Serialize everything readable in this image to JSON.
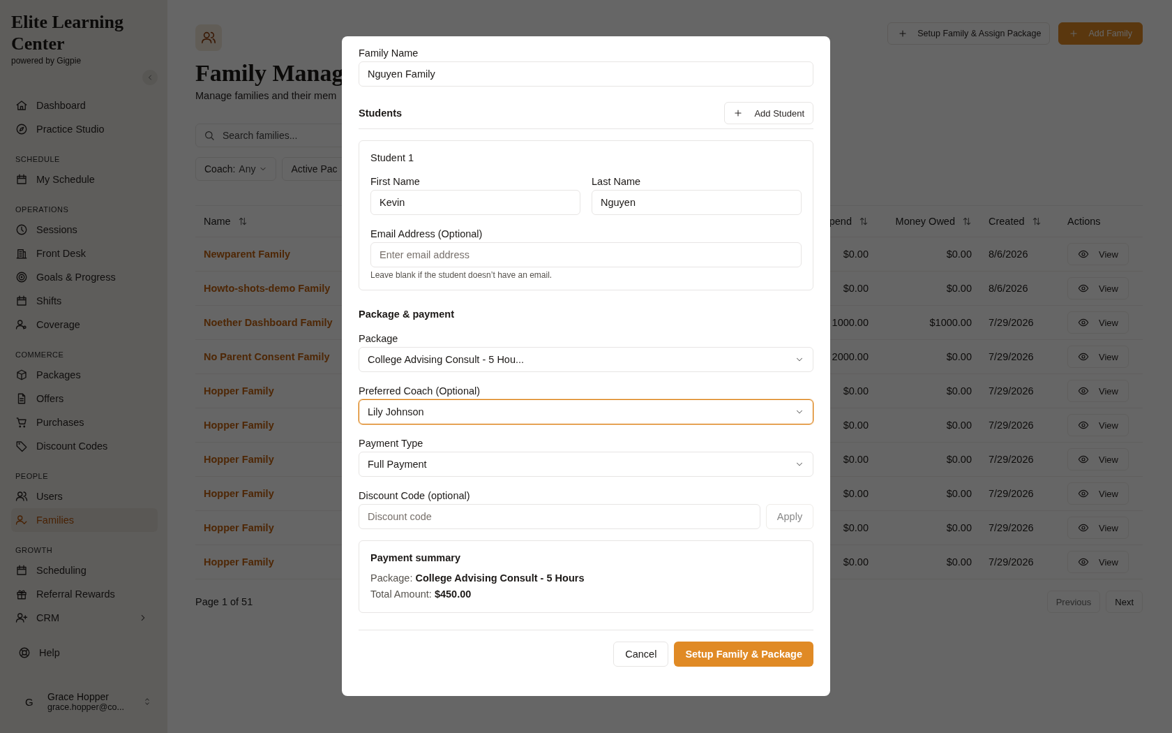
{
  "sidebar": {
    "brand": "Elite Learning Center",
    "tagline": "powered by Gigpie",
    "sections": [
      {
        "items": [
          {
            "label": "Dashboard",
            "selected": false
          },
          {
            "label": "Practice Studio",
            "selected": false
          }
        ]
      },
      {
        "heading": "SCHEDULE",
        "items": [
          {
            "label": "My Schedule",
            "selected": false
          }
        ]
      },
      {
        "heading": "OPERATIONS",
        "items": [
          {
            "label": "Sessions",
            "selected": false
          },
          {
            "label": "Front Desk",
            "selected": false
          },
          {
            "label": "Goals & Progress",
            "selected": false
          },
          {
            "label": "Shifts",
            "selected": false
          },
          {
            "label": "Coverage",
            "selected": false
          }
        ]
      },
      {
        "heading": "COMMERCE",
        "items": [
          {
            "label": "Packages",
            "selected": false
          },
          {
            "label": "Offers",
            "selected": false
          },
          {
            "label": "Purchases",
            "selected": false
          },
          {
            "label": "Discount Codes",
            "selected": false
          }
        ]
      },
      {
        "heading": "PEOPLE",
        "items": [
          {
            "label": "Users",
            "selected": false
          },
          {
            "label": "Families",
            "selected": true
          }
        ]
      },
      {
        "heading": "GROWTH",
        "items": [
          {
            "label": "Scheduling",
            "selected": false
          },
          {
            "label": "Referral Rewards",
            "selected": false
          },
          {
            "label": "CRM",
            "selected": false,
            "expanded": false
          }
        ]
      }
    ],
    "help": "Help",
    "user": {
      "initial": "G",
      "name": "Grace Hopper",
      "email": "grace.hopper@co..."
    }
  },
  "header": {
    "title": "Family Manag",
    "subtitle": "Manage families and their mem",
    "buttons": [
      {
        "label": "Setup Family & Assign Package",
        "primary": false
      },
      {
        "label": "Add Family",
        "primary": true
      }
    ]
  },
  "search": {
    "placeholder": "Search families..."
  },
  "filters": [
    {
      "label": "Coach:",
      "value": "Any"
    },
    {
      "label": "Active Pac"
    }
  ],
  "table": {
    "columns": [
      {
        "label": "Name",
        "sortable": true
      },
      {
        "label": "pend",
        "sortable": true
      },
      {
        "label": "Money Owed",
        "sortable": true
      },
      {
        "label": "Created",
        "sortable": true
      },
      {
        "label": "Actions",
        "sortable": false
      }
    ],
    "rows": [
      {
        "name": "Newparent Family",
        "column_2": "$0.00",
        "money_owed": "$0.00",
        "created": "8/6/2026",
        "action": "View"
      },
      {
        "name": "Howto-shots-demo Family",
        "column_2": "$0.00",
        "money_owed": "$0.00",
        "created": "8/6/2026",
        "action": "View"
      },
      {
        "name": "Noether Dashboard Family",
        "column_2": "1000.00",
        "money_owed": "$1000.00",
        "created": "7/29/2026",
        "action": "View"
      },
      {
        "name": "No Parent Consent Family",
        "column_2": "2000.00",
        "money_owed": "$0.00",
        "created": "7/29/2026",
        "action": "View"
      },
      {
        "name": "Hopper Family",
        "column_2": "$0.00",
        "money_owed": "$0.00",
        "created": "7/29/2026",
        "action": "View"
      },
      {
        "name": "Hopper Family",
        "column_2": "$0.00",
        "money_owed": "$0.00",
        "created": "7/29/2026",
        "action": "View"
      },
      {
        "name": "Hopper Family",
        "column_2": "$0.00",
        "money_owed": "$0.00",
        "created": "7/29/2026",
        "action": "View"
      },
      {
        "name": "Hopper Family",
        "column_2": "$0.00",
        "money_owed": "$0.00",
        "created": "7/29/2026",
        "action": "View"
      },
      {
        "name": "Hopper Family",
        "column_2": "$0.00",
        "money_owed": "$0.00",
        "created": "7/29/2026",
        "action": "View"
      },
      {
        "name": "Hopper Family",
        "column_2": "$0.00",
        "money_owed": "$0.00",
        "created": "7/29/2026",
        "action": "View"
      }
    ]
  },
  "pagination": {
    "text": "Page 1 of 51",
    "buttons": [
      {
        "label": "Previous",
        "disabled": true
      },
      {
        "label": "Next",
        "disabled": false
      }
    ]
  },
  "modal": {
    "family_name": {
      "label": "Family Name",
      "value": "Nguyen Family"
    },
    "students_heading": "Students",
    "add_student": "Add Student",
    "students": [
      {
        "title": "Student 1",
        "first_name": {
          "label": "First Name",
          "value": "Kevin"
        },
        "last_name": {
          "label": "Last Name",
          "value": "Nguyen"
        },
        "email": {
          "label": "Email Address (Optional)",
          "placeholder": "Enter email address",
          "hint": "Leave blank if the student doesn’t have an email."
        }
      }
    ],
    "package_heading": "Package & payment",
    "selects": [
      {
        "label": "Package",
        "value": "College Advising Consult - 5 Hou...",
        "focused": false
      },
      {
        "label": "Preferred Coach (Optional)",
        "value": "Lily Johnson",
        "focused": true
      },
      {
        "label": "Payment Type",
        "value": "Full Payment",
        "focused": false
      }
    ],
    "discount": {
      "label": "Discount Code (optional)",
      "placeholder": "Discount code",
      "apply": "Apply",
      "apply_disabled": true
    },
    "summary": {
      "title": "Payment summary",
      "lines": [
        "Package: **College Advising Consult - 5 Hours**",
        "Total Amount: **$450.00**"
      ]
    },
    "cancel": "Cancel",
    "submit": "Setup Family & Package"
  }
}
